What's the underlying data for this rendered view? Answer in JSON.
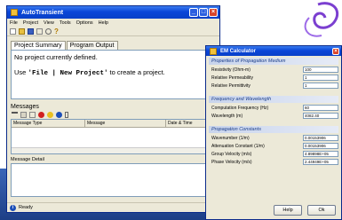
{
  "main": {
    "title": "AutoTransient",
    "menu": [
      "File",
      "Project",
      "View",
      "Tools",
      "Options",
      "Help"
    ],
    "tabs": [
      "Project Summary",
      "Program Output"
    ],
    "summary_line1": "No project currently defined.",
    "summary_use": "Use",
    "summary_cmd": "'File | New Project'",
    "summary_rest": "to create a project.",
    "messages_label": "Messages",
    "columns": [
      "Message Type",
      "Message",
      "Date & Time"
    ],
    "detail_label": "Message Detail",
    "status": "Ready"
  },
  "calc": {
    "title": "EM Calculator",
    "groups": [
      {
        "heading": "Properties of Propagation Medium",
        "rows": [
          {
            "label": "Resistivity (Ohm-m)",
            "value": "100"
          },
          {
            "label": "Relative Permeability",
            "value": "1"
          },
          {
            "label": "Relative Permittivity",
            "value": "1"
          }
        ]
      },
      {
        "heading": "Frequency and Wavelength",
        "rows": [
          {
            "label": "Computation Frequency (Hz)",
            "value": "60"
          },
          {
            "label": "Wavelength (m)",
            "value": "4082.40"
          }
        ]
      },
      {
        "heading": "Propagation Constants",
        "rows": [
          {
            "label": "Wavenumber (1/m)",
            "value": "0.00153906"
          },
          {
            "label": "Attenuation Constant (1/m)",
            "value": "0.00153906"
          },
          {
            "label": "Group Velocity (m/s)",
            "value": "4.89898E+05"
          },
          {
            "label": "Phase Velocity (m/s)",
            "value": "2.44949E+05"
          }
        ]
      }
    ],
    "help_label": "Help",
    "ok_label": "Ok"
  },
  "colors": {
    "titlebar": "#0a46d8",
    "background_band": "#2a55a8",
    "logo": "#7b3fd0"
  }
}
